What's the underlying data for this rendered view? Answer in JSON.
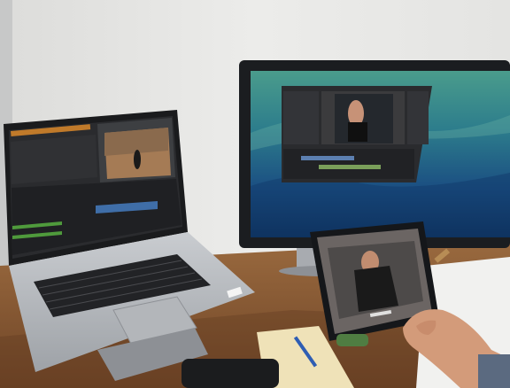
{
  "scene": {
    "subjects": [
      "laptop",
      "external-monitor",
      "tablet",
      "hand",
      "desk",
      "wall"
    ],
    "colors": {
      "wall": "#e9e9e6",
      "desk": "#8a5a34",
      "monitor_bezel": "#1b1d20",
      "ocean_top": "#3d8f86",
      "ocean_bottom": "#0e2c55",
      "editor_ui": "#2a2b2e",
      "laptop_body": "#b9bcc0",
      "tablet_frame": "#15171a",
      "skin": "#d7a07f",
      "timeline_blue": "#3f6ea8"
    }
  }
}
